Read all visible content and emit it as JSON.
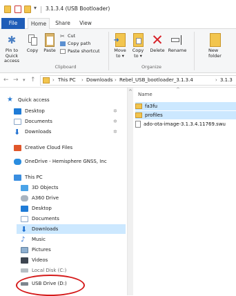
{
  "window": {
    "title": "3.1.3.4 (USB Bootloader)",
    "qa_dropdown": "▾"
  },
  "tabs": [
    "File",
    "Home",
    "Share",
    "View"
  ],
  "ribbon": {
    "clipboard": {
      "pin": "Pin to Quick access",
      "copy": "Copy",
      "paste": "Paste",
      "cut": "Cut",
      "copy_path": "Copy path",
      "paste_shortcut": "Paste shortcut",
      "label": "Clipboard"
    },
    "organize": {
      "move_to": "Move to ▾",
      "copy_to": "Copy to ▾",
      "delete": "Delete",
      "rename": "Rename",
      "label": "Organize"
    },
    "new": {
      "new_folder": "New folder"
    }
  },
  "address": {
    "back": "←",
    "forward": "→",
    "recent": "▾",
    "up": "↑",
    "crumbs": [
      "This PC",
      "Downloads",
      "Rebel_USB_bootloader_3.1.3.4",
      "3.1.3"
    ]
  },
  "nav": {
    "quick_access": {
      "label": "Quick access",
      "items": [
        {
          "label": "Desktop",
          "icon": "desktop-icon",
          "pinned": true
        },
        {
          "label": "Documents",
          "icon": "documents-icon",
          "pinned": true
        },
        {
          "label": "Downloads",
          "icon": "downloads-icon",
          "pinned": true
        }
      ]
    },
    "creative_cloud": "Creative Cloud Files",
    "onedrive": "OneDrive - Hemisphere GNSS, Inc",
    "this_pc": {
      "label": "This PC",
      "items": [
        {
          "label": "3D Objects",
          "icon": "3d-objects-icon"
        },
        {
          "label": "A360 Drive",
          "icon": "cloud-drive-icon"
        },
        {
          "label": "Desktop",
          "icon": "desktop-icon"
        },
        {
          "label": "Documents",
          "icon": "documents-icon"
        },
        {
          "label": "Downloads",
          "icon": "downloads-icon",
          "selected": true
        },
        {
          "label": "Music",
          "icon": "music-icon"
        },
        {
          "label": "Pictures",
          "icon": "pictures-icon"
        },
        {
          "label": "Videos",
          "icon": "videos-icon"
        },
        {
          "label": "Local Disk (C:)",
          "icon": "local-disk-icon"
        },
        {
          "label": "USB Drive (D:)",
          "icon": "usb-drive-icon"
        }
      ]
    },
    "pin_glyph": "✲"
  },
  "list": {
    "column_name": "Name",
    "sort_glyph": "^",
    "files": [
      {
        "name": "fa3fu",
        "type": "folder",
        "selected": true
      },
      {
        "name": "profiles",
        "type": "folder",
        "selected": true
      },
      {
        "name": "ado-ota-image-3.1.3.4.11769.swu",
        "type": "file",
        "selected": false
      }
    ]
  },
  "colors": {
    "file_tab": "#1f5db8",
    "selection": "#cce8ff",
    "folder": "#f2c54e",
    "annotation_circle": "#d51a1a",
    "delete_x": "#d8232a"
  }
}
